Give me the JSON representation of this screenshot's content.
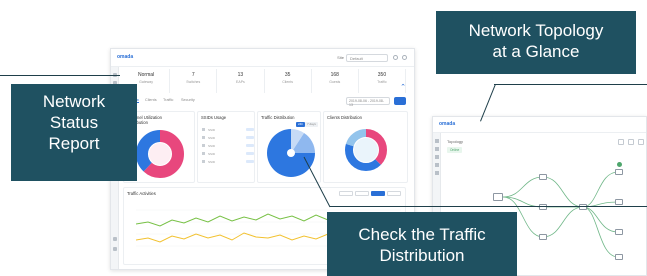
{
  "callouts": {
    "status_report": [
      "Network",
      "Status",
      "Report"
    ],
    "topology": [
      "Network Topology",
      "at a Glance"
    ],
    "traffic": [
      "Check the Traffic",
      "Distribution"
    ]
  },
  "dashboard": {
    "logo": "omada",
    "logo_sub": "omada",
    "site_label": "Site",
    "site_value": "Default",
    "stats": [
      {
        "value": "Normal",
        "label": "Gateway"
      },
      {
        "value": "7",
        "label": "Switches"
      },
      {
        "value": "13",
        "label": "EAPs"
      },
      {
        "value": "35",
        "label": "Clients"
      },
      {
        "value": "168",
        "label": "Guests"
      },
      {
        "value": "350",
        "label": "Traffic"
      }
    ],
    "tabs": [
      "Overview",
      "Clients",
      "Traffic",
      "Security"
    ],
    "date_range": "2019-08-06 - 2019-08-13",
    "panels": {
      "channel": "Channel Utilization Distribution",
      "ssids": "SSIDs Usage",
      "traffic": "Traffic Distribution",
      "clients": "Clients Distribution"
    },
    "traffic_toggle": [
      "24h",
      "7 days"
    ],
    "ssid_rows": [
      "SSID",
      "SSID",
      "SSID",
      "SSID",
      "SSID"
    ],
    "activities_title": "Traffic Activities"
  },
  "topology": {
    "logo": "omada",
    "title": "Topology",
    "legend": "Online"
  },
  "colors": {
    "callout_bg": "#1f5161",
    "accent": "#2a6fd6",
    "donut_pink": "#e8477d",
    "donut_blue": "#2d77e0",
    "series_green": "#76c043",
    "series_yellow": "#f2c12e"
  }
}
